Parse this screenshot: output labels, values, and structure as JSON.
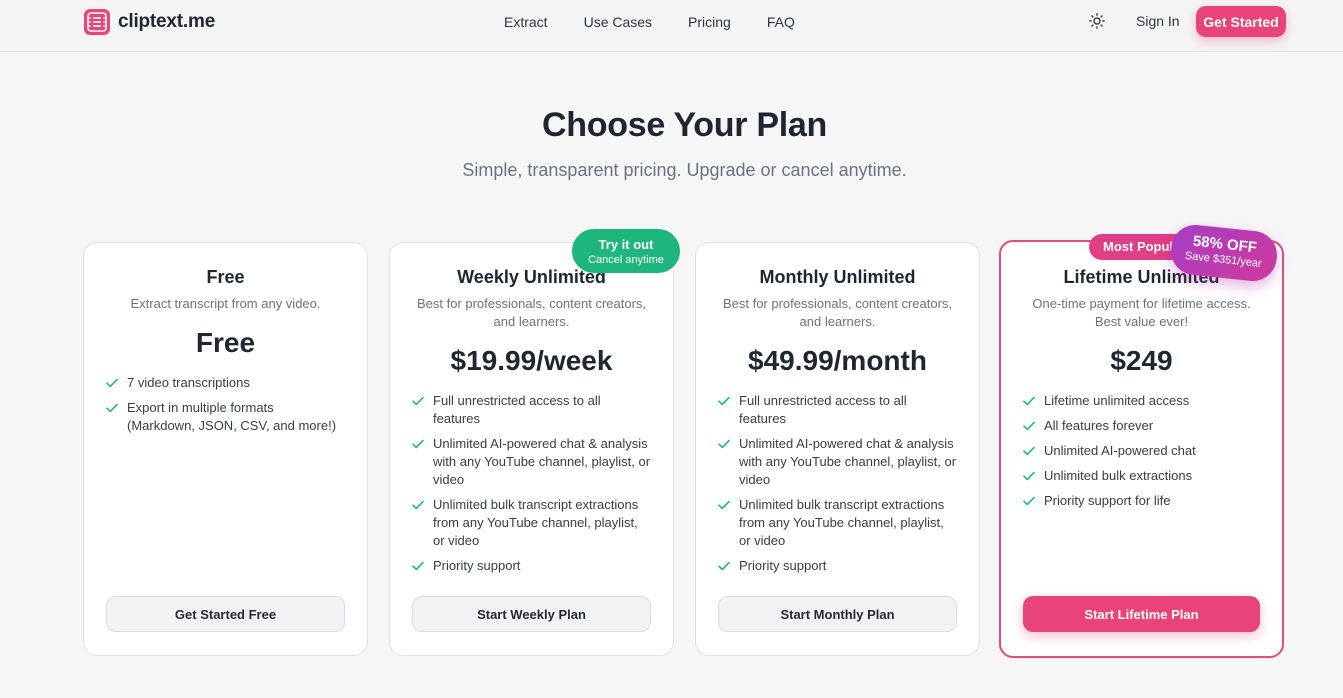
{
  "brand": {
    "name": "cliptext.me",
    "accent": "#e9447a"
  },
  "nav": {
    "links": [
      "Extract",
      "Use Cases",
      "Pricing",
      "FAQ"
    ],
    "theme_icon": "sun-icon",
    "signin": "Sign In",
    "cta": "Get Started"
  },
  "hero": {
    "title": "Choose Your Plan",
    "subtitle": "Simple, transparent pricing. Upgrade or cancel anytime."
  },
  "plans": [
    {
      "title": "Free",
      "description": "Extract transcript from any video.",
      "price": "Free",
      "features": [
        "7 video transcriptions",
        "Export in multiple formats (Markdown, JSON, CSV, and more!)"
      ],
      "button": "Get Started Free"
    },
    {
      "title": "Weekly Unlimited",
      "description": "Best for professionals, content creators, and learners.",
      "price": "$19.99/week",
      "features": [
        "Full unrestricted access to all features",
        "Unlimited AI-powered chat & analysis with any YouTube channel, playlist, or video",
        "Unlimited bulk transcript extractions from any YouTube channel, playlist, or video",
        "Priority support"
      ],
      "button": "Start Weekly Plan",
      "badge": {
        "line1": "Try it out",
        "line2": "Cancel anytime",
        "color": "#1fb67d"
      }
    },
    {
      "title": "Monthly Unlimited",
      "description": "Best for professionals, content creators, and learners.",
      "price": "$49.99/month",
      "features": [
        "Full unrestricted access to all features",
        "Unlimited AI-powered chat & analysis with any YouTube channel, playlist, or video",
        "Unlimited bulk transcript extractions from any YouTube channel, playlist, or video",
        "Priority support"
      ],
      "button": "Start Monthly Plan"
    },
    {
      "title": "Lifetime Unlimited",
      "description": "One-time payment for lifetime access. Best value ever!",
      "price": "$249",
      "features": [
        "Lifetime unlimited access",
        "All features forever",
        "Unlimited AI-powered chat",
        "Unlimited bulk extractions",
        "Priority support for life"
      ],
      "button": "Start Lifetime Plan",
      "popular_badge": "Most Popular",
      "discount": {
        "line1": "58% OFF",
        "line2": "Save $351/year"
      }
    }
  ]
}
